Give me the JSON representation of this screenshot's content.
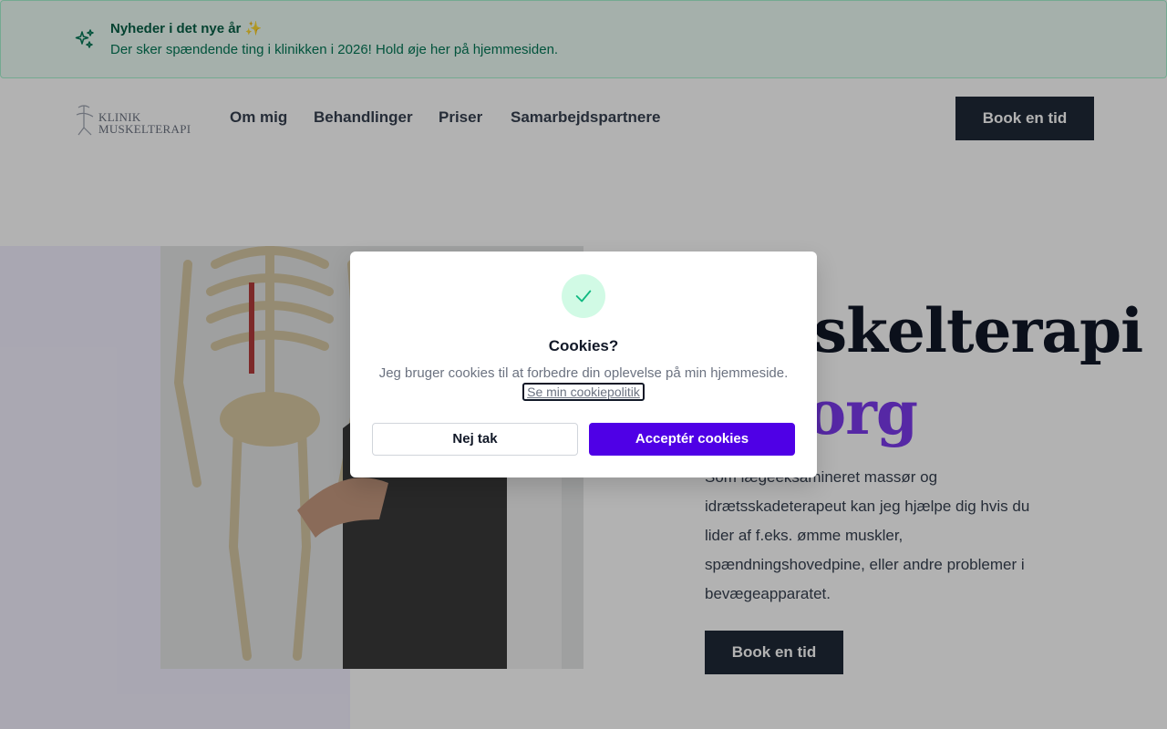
{
  "banner": {
    "icon": "sparkles-icon",
    "title": "Nyheder i det nye år ✨",
    "text": "Der sker spændende ting i klinikken i 2026! Hold øje her på hjemmesiden."
  },
  "header": {
    "logo_line1": "KLINIK",
    "logo_line2": "MUSKELTERAPI",
    "nav": [
      "Om mig",
      "Behandlinger",
      "Priser",
      "Samarbejdspartnere"
    ],
    "cta": "Book en tid"
  },
  "hero": {
    "title_line1": "Muskelterapi",
    "title_line2": "...borg",
    "description": "Som lægeeksamineret massør og idrætsskadeterapeut kan jeg hjælpe dig hvis du lider af f.eks. ømme muskler, spændningshovedpine, eller andre problemer i bevægeapparatet.",
    "cta": "Book en tid"
  },
  "cookie_dialog": {
    "icon": "check-icon",
    "title": "Cookies?",
    "text": "Jeg bruger cookies til at forbedre din oplevelse på min hjemmeside.",
    "link": "Se min cookiepolitik",
    "decline": "Nej tak",
    "accept": "Acceptér cookies"
  },
  "colors": {
    "accent": "#4f00e6",
    "banner_bg": "#ecfdf5",
    "dark_button": "#1f2937",
    "hero_highlight": "#7c3aed"
  }
}
